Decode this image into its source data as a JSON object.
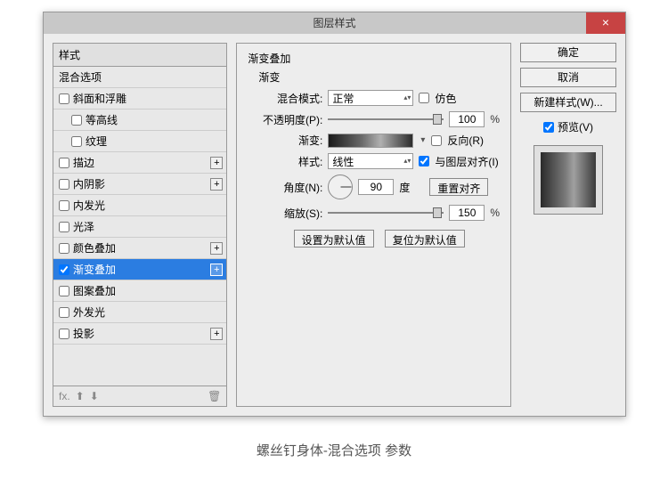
{
  "dialog": {
    "title": "图层样式",
    "close": "×"
  },
  "left": {
    "header": "样式",
    "blend_options": "混合选项",
    "effects": [
      {
        "label": "斜面和浮雕",
        "checked": false,
        "indent": false,
        "plus": false
      },
      {
        "label": "等高线",
        "checked": false,
        "indent": true,
        "plus": false
      },
      {
        "label": "纹理",
        "checked": false,
        "indent": true,
        "plus": false
      },
      {
        "label": "描边",
        "checked": false,
        "indent": false,
        "plus": true
      },
      {
        "label": "内阴影",
        "checked": false,
        "indent": false,
        "plus": true
      },
      {
        "label": "内发光",
        "checked": false,
        "indent": false,
        "plus": false
      },
      {
        "label": "光泽",
        "checked": false,
        "indent": false,
        "plus": false
      },
      {
        "label": "颜色叠加",
        "checked": false,
        "indent": false,
        "plus": true
      },
      {
        "label": "渐变叠加",
        "checked": true,
        "indent": false,
        "plus": true,
        "selected": true
      },
      {
        "label": "图案叠加",
        "checked": false,
        "indent": false,
        "plus": false
      },
      {
        "label": "外发光",
        "checked": false,
        "indent": false,
        "plus": false
      },
      {
        "label": "投影",
        "checked": false,
        "indent": false,
        "plus": true
      }
    ],
    "footer_fx": "fx."
  },
  "mid": {
    "section_title": "渐变叠加",
    "subsection_title": "渐变",
    "blend_mode_label": "混合模式:",
    "blend_mode_value": "正常",
    "dither_label": "仿色",
    "opacity_label": "不透明度(P):",
    "opacity_value": "100",
    "pct": "%",
    "gradient_label": "渐变:",
    "reverse_label": "反向(R)",
    "style_label": "样式:",
    "style_value": "线性",
    "align_label": "与图层对齐(I)",
    "angle_label": "角度(N):",
    "angle_value": "90",
    "angle_unit": "度",
    "reset_align": "重置对齐",
    "scale_label": "缩放(S):",
    "scale_value": "150",
    "set_default": "设置为默认值",
    "reset_default": "复位为默认值"
  },
  "right": {
    "ok": "确定",
    "cancel": "取消",
    "new_style": "新建样式(W)...",
    "preview_label": "预览(V)"
  },
  "caption": "螺丝钉身体-混合选项 参数"
}
